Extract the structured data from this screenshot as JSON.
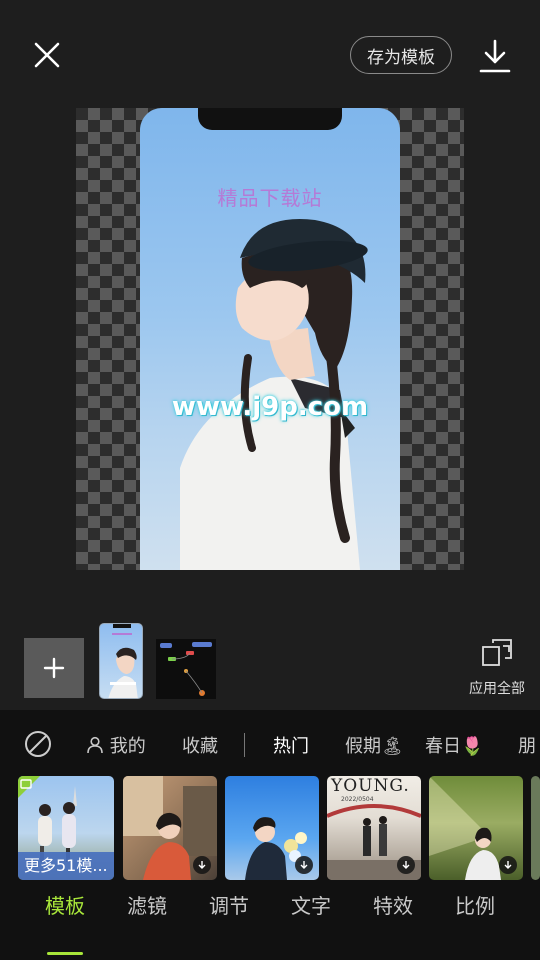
{
  "topbar": {
    "close_icon": "close-icon",
    "save_template_label": "存为模板",
    "download_icon": "download-icon"
  },
  "preview": {
    "watermark_cn": "精品下载站",
    "watermark_url": "www.j9p.com"
  },
  "timeline": {
    "add_icon": "plus-icon",
    "apply_all_label": "应用全部",
    "apply_all_icon": "apply-all-icon"
  },
  "template_tabs": {
    "none_icon": "no-filter-icon",
    "items": [
      {
        "label": "我的",
        "icon": "user-icon"
      },
      {
        "label": "收藏"
      },
      {
        "label": "热门"
      },
      {
        "label": "假期🏝"
      },
      {
        "label": "春日🌷"
      },
      {
        "label": "朋"
      }
    ]
  },
  "template_thumbs": {
    "more_label": "更多51模...",
    "young_text": "YOUNG.",
    "young_date": "2022/0504"
  },
  "bottom_nav": {
    "items": [
      "模板",
      "滤镜",
      "调节",
      "文字",
      "特效",
      "比例"
    ],
    "active_index": 0
  },
  "colors": {
    "accent": "#a8e63a",
    "background": "#1e1e1e",
    "panel": "#111111"
  }
}
